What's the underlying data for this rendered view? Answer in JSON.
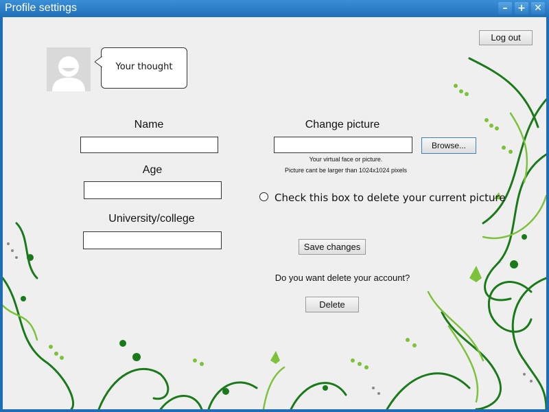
{
  "window": {
    "title": "Profile settings",
    "controls": {
      "minimize": "–",
      "maximize": "+",
      "close": "✕"
    }
  },
  "header": {
    "logout_label": "Log out",
    "thought_text": "Your thought"
  },
  "form": {
    "name_label": "Name",
    "name_value": "",
    "age_label": "Age",
    "age_value": "",
    "university_label": "University/college",
    "university_value": ""
  },
  "picture": {
    "label": "Change picture",
    "file_value": "",
    "browse_label": "Browse...",
    "help_line1": "Your virtual face or picture.",
    "help_line2": "Picture cant be  larger than 1024x1024 pixels",
    "delete_checkbox_label": "Check this box to delete your current picture"
  },
  "actions": {
    "save_label": "Save changes",
    "delete_question": "Do you want delete your account?",
    "delete_label": "Delete"
  },
  "colors": {
    "titlebar": "#1f6fb8",
    "content_bg": "#efefef",
    "vine_dark": "#1a7a1a",
    "vine_light": "#7cc23a"
  }
}
